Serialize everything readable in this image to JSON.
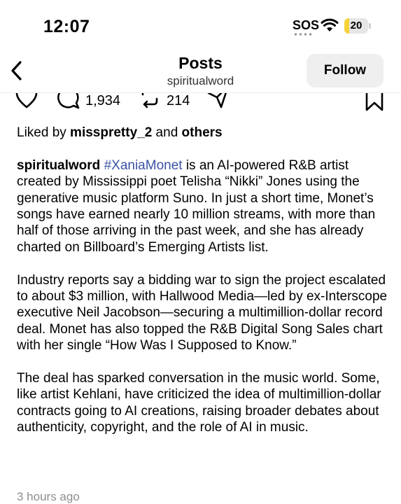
{
  "status_bar": {
    "time": "12:07",
    "sos": "SOS",
    "battery": "20",
    "battery_level": 0.2,
    "accent_battery": "#f6d23a"
  },
  "header": {
    "title": "Posts",
    "subtitle": "spiritualword",
    "follow_label": "Follow",
    "back_icon": "chevron-left-icon"
  },
  "actions": {
    "comments_count": "1,934",
    "reposts_count": "214",
    "icons": [
      "heart-icon",
      "comment-icon",
      "repost-icon",
      "share-icon",
      "bookmark-icon"
    ]
  },
  "post": {
    "liked_prefix": "Liked by ",
    "liked_user": "misspretty_2",
    "liked_mid": " and ",
    "liked_others": "others",
    "author": "spiritualword",
    "hashtag": "#XaniaMonet",
    "hashtag_color": "#3b53a4",
    "paragraph1_rest": " is an AI-powered R&B artist created by Mississippi poet Telisha “Nikki” Jones using the generative music platform Suno. In just a short time, Monet’s songs have earned nearly 10 million streams, with more than half of those arriving in the past week, and she has already charted on Billboard’s Emerging Artists list.",
    "paragraph2": "Industry reports say a bidding war to sign the project escalated to about $3 million, with Hallwood Media—led by ex-Interscope executive Neil Jacobson—securing a multimillion-dollar record deal. Monet has also topped the R&B Digital Song Sales chart with her single “How Was I Supposed to Know.”",
    "paragraph3": "The deal has sparked conversation in the music world. Some, like artist Kehlani, have criticized the idea of multimillion-dollar contracts going to AI creations, raising broader debates about authenticity, copyright, and the role of AI in music.",
    "time_ago": "3 hours ago"
  }
}
